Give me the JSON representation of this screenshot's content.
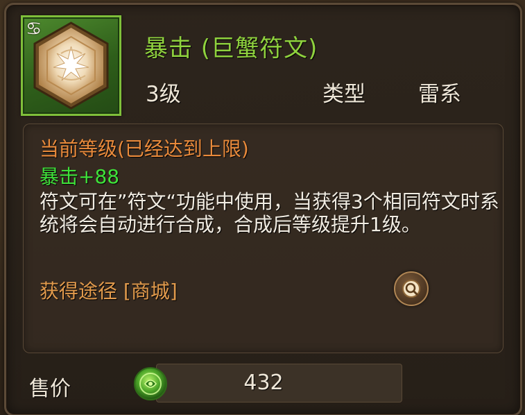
{
  "item": {
    "zodiac_symbol": "♋",
    "title": "暴击 (巨蟹符文)",
    "level": "3级",
    "type_label": "类型",
    "type_value": "雷系",
    "icon": "burst-rune-icon"
  },
  "details": {
    "current_level": "当前等级(已经达到上限)",
    "stat": "暴击+88",
    "description": "符文可在”符文“功能中使用，当获得3个相同符文时系统将会自动进行合成，合成后等级提升1级。",
    "source": "获得途径  [商城]"
  },
  "sale": {
    "label": "售价",
    "price": "432",
    "currency_icon": "green-coin-icon"
  },
  "colors": {
    "title_green": "#8fd23e",
    "stat_green": "#3fe13a",
    "level_orange": "#e98a3b",
    "source_orange": "#e19a4c",
    "text_light": "#f2ede3",
    "frame_green": "#7fbf3a"
  }
}
